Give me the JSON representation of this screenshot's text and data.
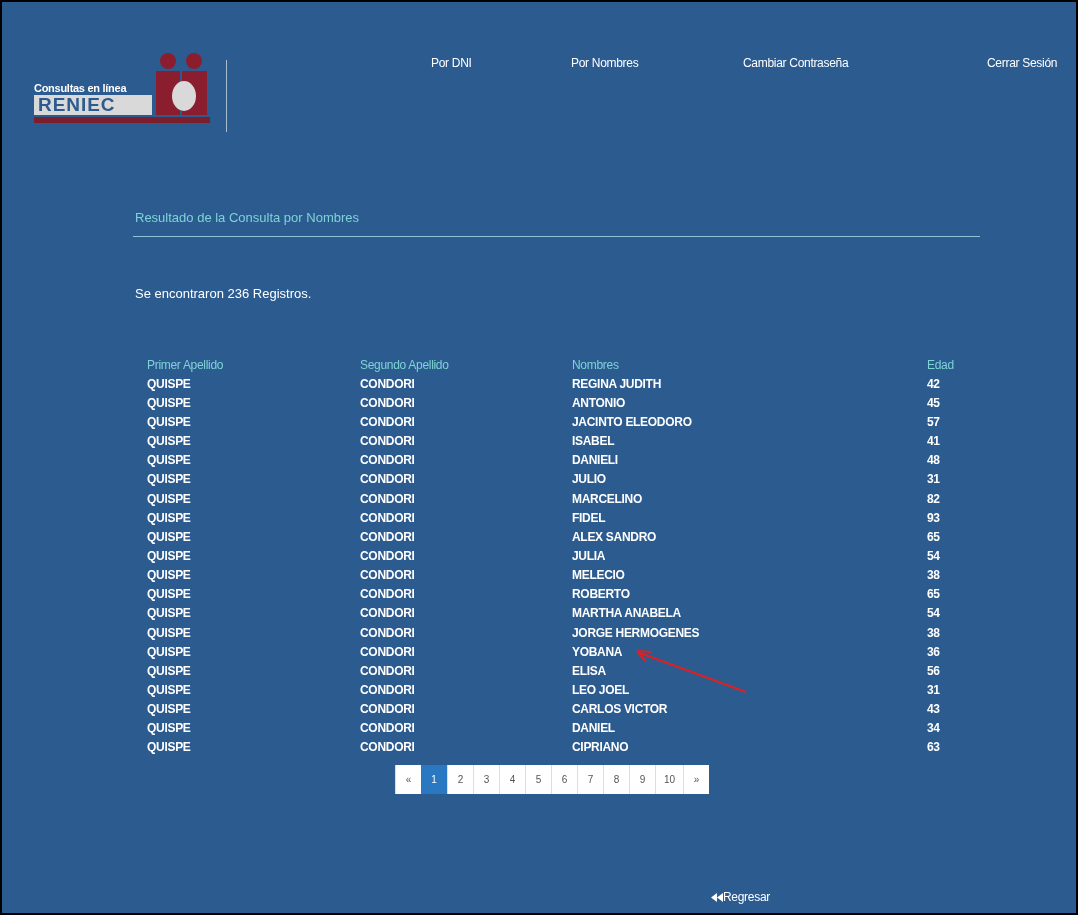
{
  "logo": {
    "tagline": "Consultas en línea",
    "name": "RENIEC"
  },
  "nav": [
    "Por DNI",
    "Por Nombres",
    "Cambiar Contraseña",
    "Cerrar Sesión"
  ],
  "title": "Resultado de la Consulta por Nombres",
  "summary": "Se encontraron 236 Registros.",
  "table": {
    "columns": [
      "Primer Apellido",
      "Segundo Apellido",
      "Nombres",
      "Edad"
    ],
    "rows": [
      [
        "QUISPE",
        "CONDORI",
        "REGINA JUDITH",
        "42"
      ],
      [
        "QUISPE",
        "CONDORI",
        "ANTONIO",
        "45"
      ],
      [
        "QUISPE",
        "CONDORI",
        "JACINTO ELEODORO",
        "57"
      ],
      [
        "QUISPE",
        "CONDORI",
        "ISABEL",
        "41"
      ],
      [
        "QUISPE",
        "CONDORI",
        "DANIELI",
        "48"
      ],
      [
        "QUISPE",
        "CONDORI",
        "JULIO",
        "31"
      ],
      [
        "QUISPE",
        "CONDORI",
        "MARCELINO",
        "82"
      ],
      [
        "QUISPE",
        "CONDORI",
        "FIDEL",
        "93"
      ],
      [
        "QUISPE",
        "CONDORI",
        "ALEX SANDRO",
        "65"
      ],
      [
        "QUISPE",
        "CONDORI",
        "JULIA",
        "54"
      ],
      [
        "QUISPE",
        "CONDORI",
        "MELECIO",
        "38"
      ],
      [
        "QUISPE",
        "CONDORI",
        "ROBERTO",
        "65"
      ],
      [
        "QUISPE",
        "CONDORI",
        "MARTHA ANABELA",
        "54"
      ],
      [
        "QUISPE",
        "CONDORI",
        "JORGE HERMOGENES",
        "38"
      ],
      [
        "QUISPE",
        "CONDORI",
        "YOBANA",
        "36"
      ],
      [
        "QUISPE",
        "CONDORI",
        "ELISA",
        "56"
      ],
      [
        "QUISPE",
        "CONDORI",
        "LEO JOEL",
        "31"
      ],
      [
        "QUISPE",
        "CONDORI",
        "CARLOS VICTOR",
        "43"
      ],
      [
        "QUISPE",
        "CONDORI",
        "DANIEL",
        "34"
      ],
      [
        "QUISPE",
        "CONDORI",
        "CIPRIANO",
        "63"
      ]
    ]
  },
  "pagination": [
    {
      "label": "«",
      "selected": false
    },
    {
      "label": "1",
      "selected": true
    },
    {
      "label": "2",
      "selected": false
    },
    {
      "label": "3",
      "selected": false
    },
    {
      "label": "4",
      "selected": false
    },
    {
      "label": "5",
      "selected": false
    },
    {
      "label": "6",
      "selected": false
    },
    {
      "label": "7",
      "selected": false
    },
    {
      "label": "8",
      "selected": false
    },
    {
      "label": "9",
      "selected": false
    },
    {
      "label": "10",
      "selected": false
    },
    {
      "label": "»",
      "selected": false
    }
  ],
  "back_link": "Regresar"
}
